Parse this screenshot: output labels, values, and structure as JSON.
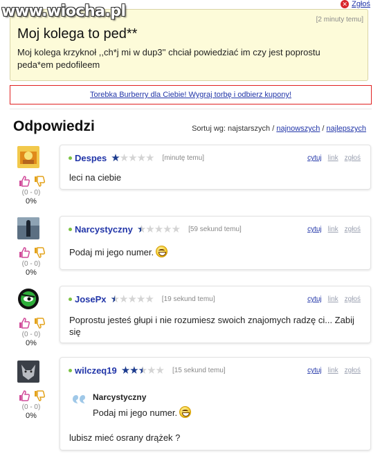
{
  "watermark": "www.wiocha.pl",
  "report": {
    "label": "Zgłoś"
  },
  "question": {
    "time": "[2 minuty temu]",
    "title": "Moj kolega to ped**",
    "body": "Moj kolega krzyknoł ,,ch*j mi w dup3'' chciał powiedziać im czy jest poprostu peda*em pedofileem"
  },
  "ad": {
    "text": "Torebka Burberry dla Ciebie! Wygraj torbę i odbierz kupony!"
  },
  "answers_header": {
    "title": "Odpowiedzi",
    "sort_label": "Sortuj wg: najstarszych /",
    "sort_newest": "najnowszych",
    "sort_sep": "/",
    "sort_best": "najlepszych"
  },
  "actions": {
    "quote": "cytuj",
    "link": "link",
    "report": "zgłoś"
  },
  "answers": [
    {
      "user": "Despes",
      "rating": 1,
      "time": "[minutę temu]",
      "text": "leci na ciebie",
      "score": "(0 - 0)",
      "percent": "0%",
      "avatar_color": "#e0a21a"
    },
    {
      "user": "Narcystyczny",
      "rating": 0.5,
      "time": "[59 sekund temu]",
      "text": "Podaj mi jego numer.",
      "score": "(0 - 0)",
      "percent": "0%",
      "avatar_color": "#41505e"
    },
    {
      "user": "JosePx",
      "rating": 0.5,
      "time": "[19 sekund temu]",
      "text": "Poprostu jesteś głupi i nie rozumiesz swoich znajomych radzę ci... Zabij się",
      "score": "(0 - 0)",
      "percent": "0%",
      "avatar_color": "#2e8b2e"
    },
    {
      "user": "wilczeq19",
      "rating": 2.5,
      "time": "[15 sekund temu]",
      "quote_author": "Narcystyczny",
      "quote_text": "Podaj mi jego numer.",
      "text": "lubisz mieć osrany drążek ?",
      "score": "(0 - 0)",
      "percent": "0%",
      "avatar_color": "#6a6f78"
    }
  ]
}
